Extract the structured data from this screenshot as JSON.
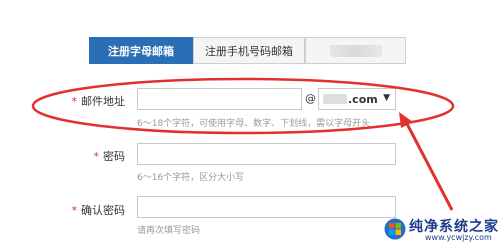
{
  "tabs": {
    "email": "注册字母邮箱",
    "mobile": "注册手机号码邮箱"
  },
  "form": {
    "required_mark": "*",
    "email_label": "邮件地址",
    "email_value": "",
    "at_sign": "@",
    "domain_suffix": ".com",
    "email_hint": "6～18个字符，可使用字母、数字、下划线，需以字母开头",
    "password_label": "密码",
    "password_hint": "6～16个字符，区分大小写",
    "confirm_label": "确认密码",
    "confirm_hint": "请再次填写密码"
  },
  "watermark": {
    "title": "纯净系统之家",
    "url": "www.ycwjzy.com"
  },
  "colors": {
    "tab_active": "#2a6fb5",
    "annotation": "#e0312c",
    "required": "#e0312c",
    "watermark": "#1f3d8f"
  },
  "icons": {
    "dropdown": "chevron-down-icon",
    "logo": "windows-logo-icon"
  }
}
